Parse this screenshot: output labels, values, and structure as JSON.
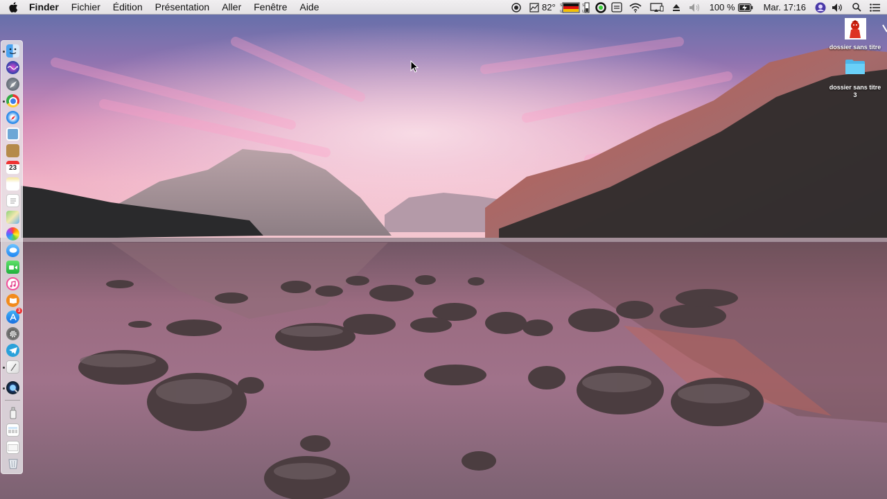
{
  "menubar": {
    "apple_icon": "apple-logo-icon",
    "app_name": "Finder",
    "menus": [
      "Fichier",
      "Édition",
      "Présentation",
      "Aller",
      "Fenêtre",
      "Aide"
    ],
    "status": {
      "temperature": "82°",
      "battery_percent": "100 %",
      "clock": "Mar. 17:16"
    }
  },
  "desktop": {
    "icons": [
      {
        "label": "dossier sans titre",
        "icon": "red-character-folder-icon"
      },
      {
        "label": "dossier sans titre",
        "label_line2": "3",
        "icon": "blue-folder-icon"
      }
    ]
  },
  "dock": {
    "items": [
      "finder",
      "siri",
      "launchpad",
      "chrome",
      "safari",
      "preview",
      "notes-book",
      "calendar",
      "stickies",
      "textedit",
      "maps",
      "photos",
      "messages",
      "facetime",
      "itunes",
      "ibooks",
      "app-store",
      "system-preferences",
      "telegram",
      "script-editor",
      "quicktime",
      "usb-drive",
      "calculator-window",
      "desktop-window",
      "trash"
    ],
    "calendar_day": "23",
    "app_store_badge": "3"
  },
  "colors": {
    "menubar_bg": "#ebe9eb",
    "dock_bg": "#e6e4e8",
    "folder_blue": "#5ec8f5"
  }
}
